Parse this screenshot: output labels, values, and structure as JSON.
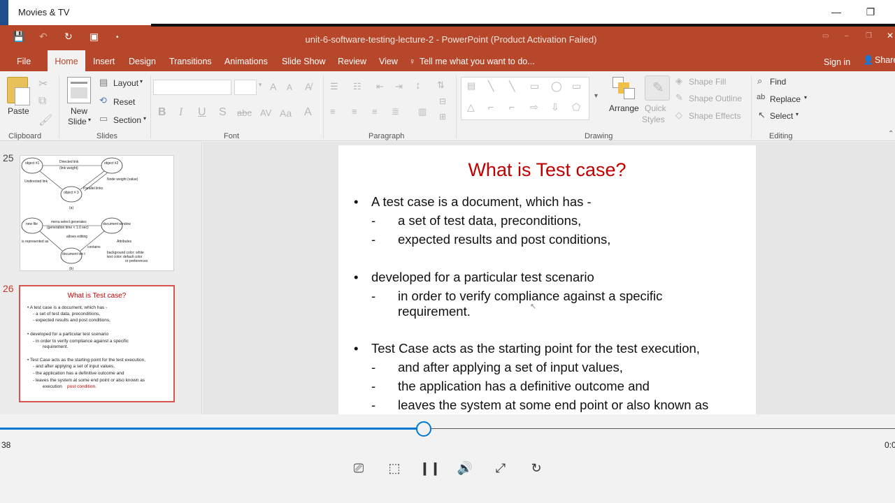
{
  "app": {
    "title": "Movies & TV"
  },
  "ppt": {
    "window_title": "unit-6-software-testing-lecture-2 - PowerPoint (Product Activation Failed)",
    "tabs": [
      "File",
      "Home",
      "Insert",
      "Design",
      "Transitions",
      "Animations",
      "Slide Show",
      "Review",
      "View"
    ],
    "tell_me": "Tell me what you want to do...",
    "sign_in": "Sign in",
    "share": "Share"
  },
  "ribbon": {
    "clipboard": {
      "paste": "Paste",
      "group": "Clipboard"
    },
    "slides": {
      "new_slide_1": "New",
      "new_slide_2": "Slide",
      "layout": "Layout",
      "reset": "Reset",
      "section": "Section",
      "group": "Slides"
    },
    "font": {
      "group": "Font"
    },
    "paragraph": {
      "group": "Paragraph"
    },
    "drawing": {
      "arrange": "Arrange",
      "quick_styles_1": "Quick",
      "quick_styles_2": "Styles",
      "shape_fill": "Shape Fill",
      "shape_outline": "Shape Outline",
      "shape_effects": "Shape Effects",
      "group": "Drawing"
    },
    "editing": {
      "find": "Find",
      "replace": "Replace",
      "select": "Select",
      "group": "Editing"
    }
  },
  "thumbnails": {
    "slide25_number": "25",
    "slide26_number": "26",
    "slide25_text": {
      "obj1": "object #1",
      "obj2": "object #2",
      "obj3": "object # 3",
      "directed": "Directed link",
      "weight": "(link weight)",
      "undirected": "Undirected link",
      "parallel": "Parallel links",
      "node_weight": "Node weight (value)",
      "a": "(a)",
      "new_file": "new file",
      "menu_select": "menu select generates",
      "gen_time": "(generation time < 1.0 sec)",
      "doc_window": "document window",
      "allows_editing": "allows editing",
      "represented": "is represented as",
      "attributes": "Attributes",
      "contains": "contains",
      "doc_tex": "document tex t",
      "bg_color": "background color: white",
      "text_color": "text color: default color",
      "prefs": "or preferences",
      "b": "(b)"
    },
    "slide26": {
      "title": "What is Test case?",
      "lines": [
        "•  A test case is a document, which has  -",
        "-     a set of test data, preconditions,",
        "-     expected results and post conditions,",
        "•  developed for a particular test scenario",
        "-     in order to verify compliance against a specific",
        "requirement.",
        "•  Test Case acts as the starting point for the test execution,",
        "-     and after applying a set of input values,",
        "-     the application has a definitive outcome and",
        "-     leaves the system at some end point or also known as",
        "execution"
      ],
      "post_condition": "post condition."
    }
  },
  "slide": {
    "title": "What is Test case?",
    "bullet1": "•",
    "line1": "A test case is a document, which has  -",
    "dash": "-",
    "line2": "a set of test data, preconditions,",
    "line3": "expected results and post conditions,",
    "line4": "developed for a particular test scenario",
    "line5": "in order to verify compliance against a specific",
    "line6": "requirement.",
    "line7": "Test Case acts as the starting point for the test execution,",
    "line8": "and after applying a set of input values,",
    "line9": "the application has a definitive outcome and",
    "line10": "leaves the system at some end point or also known as"
  },
  "player": {
    "elapsed": "38",
    "remaining": "0:0",
    "progress_fraction": 0.473
  }
}
